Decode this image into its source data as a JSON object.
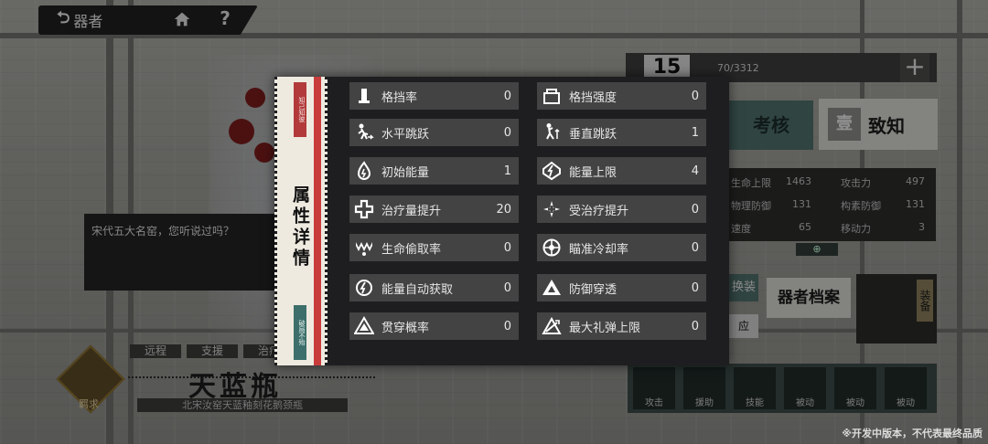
{
  "top_bar": {
    "back_label": "器者",
    "help_label": "?"
  },
  "dialog": {
    "text": "宋代五大名窑，您听说过吗？"
  },
  "item": {
    "tabs": [
      "远程",
      "支援",
      "治疗"
    ],
    "name": "天蓝瓶",
    "subtitle": "北宋汝窑天蓝釉刻花鹅颈瓶",
    "emblem_label": "羁求"
  },
  "right_panel": {
    "counter_number": "15",
    "counter_text": "70/3312",
    "plus_label": "+",
    "exam_label": "考核",
    "zhizhi_seal": "壹",
    "zhizhi_label": "致知",
    "stats": [
      {
        "label": "生命上限",
        "value": "1463"
      },
      {
        "label": "攻击力",
        "value": "497"
      },
      {
        "label": "物理防御",
        "value": "131"
      },
      {
        "label": "构素防御",
        "value": "131"
      },
      {
        "label": "速度",
        "value": "65"
      },
      {
        "label": "移动力",
        "value": "3"
      }
    ],
    "equip_label": "换装",
    "archive_label": "器者档案",
    "slot_label": "装备",
    "ying_label": "应",
    "skills": [
      "攻击",
      "援助",
      "技能",
      "被动",
      "被动",
      "被动"
    ]
  },
  "modal": {
    "title": "属性详情",
    "red_tab_text": "知己知彼",
    "teal_tab_text": "破局不殆",
    "attributes_left": [
      {
        "label": "格挡率",
        "value": "0",
        "icon": "block-rate-icon"
      },
      {
        "label": "水平跳跃",
        "value": "0",
        "icon": "horizontal-jump-icon"
      },
      {
        "label": "初始能量",
        "value": "1",
        "icon": "initial-energy-icon"
      },
      {
        "label": "治疗量提升",
        "value": "20",
        "icon": "healing-boost-icon"
      },
      {
        "label": "生命偷取率",
        "value": "0",
        "icon": "lifesteal-icon"
      },
      {
        "label": "能量自动获取",
        "value": "0",
        "icon": "energy-regen-icon"
      },
      {
        "label": "贯穿概率",
        "value": "0",
        "icon": "pierce-chance-icon"
      }
    ],
    "attributes_right": [
      {
        "label": "格挡强度",
        "value": "0",
        "icon": "block-strength-icon"
      },
      {
        "label": "垂直跳跃",
        "value": "1",
        "icon": "vertical-jump-icon"
      },
      {
        "label": "能量上限",
        "value": "4",
        "icon": "energy-cap-icon"
      },
      {
        "label": "受治疗提升",
        "value": "0",
        "icon": "healing-received-icon"
      },
      {
        "label": "瞄准冷却率",
        "value": "0",
        "icon": "aim-cooldown-icon"
      },
      {
        "label": "防御穿透",
        "value": "0",
        "icon": "defense-pierce-icon"
      },
      {
        "label": "最大礼弹上限",
        "value": "0",
        "icon": "max-ammo-icon"
      }
    ]
  },
  "notice": "※开发中版本，不代表最终品质"
}
